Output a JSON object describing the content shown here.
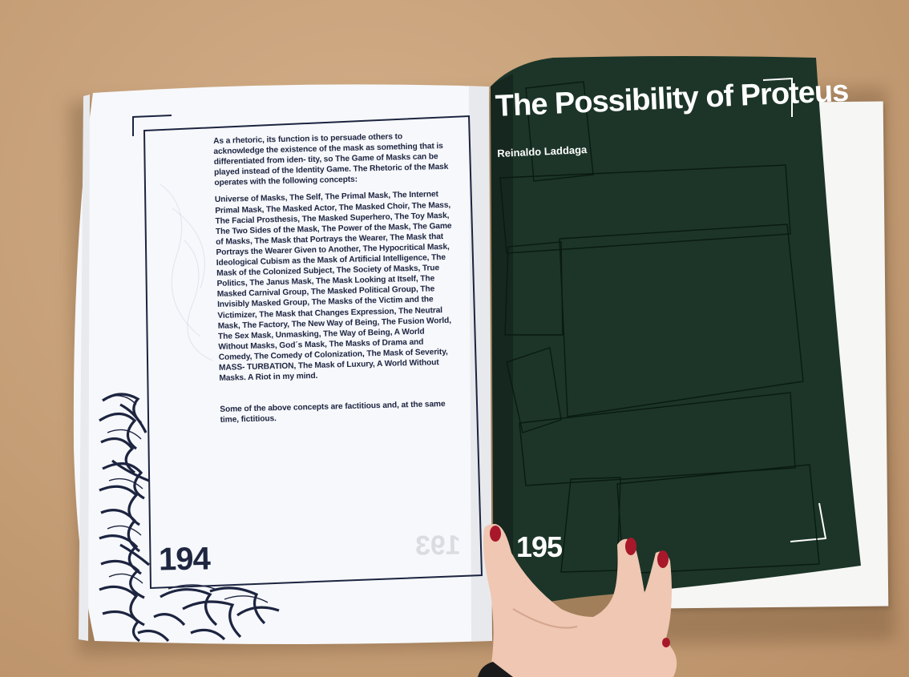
{
  "book": {
    "left_page": {
      "paragraph_1": "As a rhetoric, its function is to persuade others to acknowledge the existence of the mask as something that is differentiated from iden- tity, so The Game of Masks can be played instead of the Identity Game. The Rhetoric of the Mask operates with the following concepts:",
      "paragraph_2": "Universe of Masks, The Self, The Primal Mask, The Internet Primal Mask, The Masked Actor, The Masked Choir, The Mass, The Facial Prosthesis, The Masked Superhero, The Toy Mask, The Two Sides of the Mask, The Power of the Mask, The Game of Masks, The Mask that Portrays the Wearer, The Mask that Portrays the Wearer Given to Another, The Hypocritical Mask, Ideological Cubism as the Mask of Artificial Intelligence, The Mask of the Colonized Subject, The Society of Masks, True Politics, The Janus Mask, The Mask Looking at Itself, The Masked Carnival Group, The Masked Political Group, The Invisibly Masked Group, The Masks of the Victim and the Victimizer, The Mask that Changes Expression, The Neutral Mask, The Factory, The New Way of Being, The Fusion World, The Sex Mask, Unmasking, The Way of Being, A World Without Masks, God´s Mask, The Masks of Drama and Comedy, The Comedy of Colonization, The Mask of Severity, MASS- TURBATION, The Mask of Luxury, A World Without Masks. A Riot in my mind.",
      "paragraph_3": "Some of the above concepts are factitious and, at the same time, fictitious.",
      "page_number": "194",
      "ghost_number": "193"
    },
    "right_page": {
      "title": "The Possibility of Proteus",
      "author": "Reinaldo Laddaga",
      "page_number": "195"
    }
  },
  "colors": {
    "board": "#c9a47e",
    "left_paper": "#f7f8fb",
    "ink_navy": "#1c2440",
    "cover_green": "#1c3528",
    "line_on_green": "#0a1a12",
    "nail_polish": "#a8182a",
    "skin": "#efc7b3"
  },
  "decorations": {
    "left_pattern": "wavy-line-illustration",
    "hand": "hand-holding-page"
  }
}
